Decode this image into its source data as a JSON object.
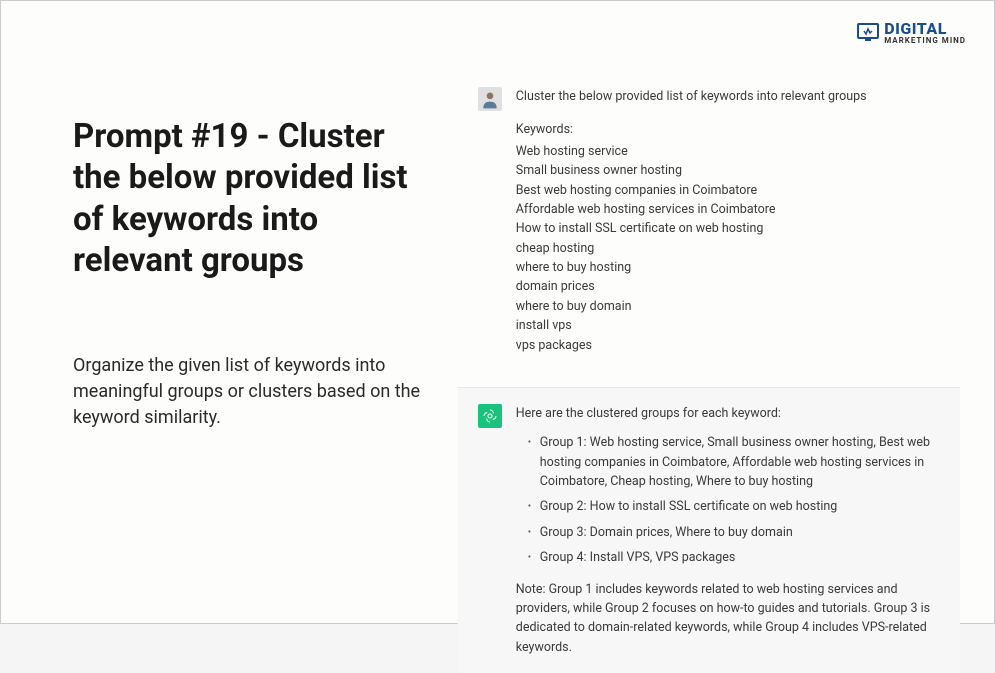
{
  "logo": {
    "main": "DIGITAL",
    "sub": "MARKETING MIND"
  },
  "left": {
    "title": "Prompt #19 - Cluster the below provided list of keywords into relevant groups",
    "description": "Organize the given list of keywords into meaningful groups or clusters based on the keyword similarity."
  },
  "chat": {
    "user": {
      "prompt_line": "Cluster the below provided list of keywords into relevant groups",
      "keywords_label": "Keywords:",
      "keywords": [
        "Web hosting service",
        "Small business owner hosting",
        "Best web hosting companies in Coimbatore",
        "Affordable web hosting services in Coimbatore",
        "How to install SSL certificate on web hosting",
        "cheap hosting",
        "where to buy hosting",
        "domain prices",
        "where to buy domain",
        "install vps",
        "vps packages"
      ]
    },
    "assistant": {
      "intro": "Here are the clustered groups for each keyword:",
      "groups": [
        "Group 1: Web hosting service, Small business owner hosting, Best web hosting companies in Coimbatore, Affordable web hosting services in Coimbatore, Cheap hosting, Where to buy hosting",
        "Group 2: How to install SSL certificate on web hosting",
        "Group 3: Domain prices, Where to buy domain",
        "Group 4: Install VPS, VPS packages"
      ],
      "note": "Note: Group 1 includes keywords related to web hosting services and providers, while Group 2 focuses on how-to guides and tutorials. Group 3 is dedicated to domain-related keywords, while Group 4 includes VPS-related keywords."
    }
  }
}
